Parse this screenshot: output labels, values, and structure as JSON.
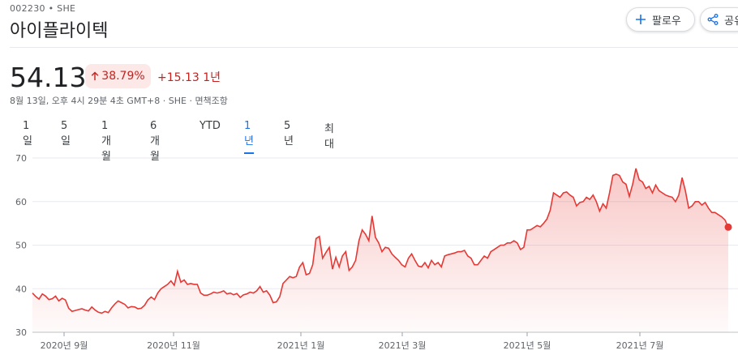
{
  "header": {
    "ticker": "002230 • SHE",
    "company": "아이플라이텍",
    "follow_label": "팔로우",
    "share_label": "공유"
  },
  "quote": {
    "price": "54.13",
    "change_pct": "38.79%",
    "change_abs": "+15.13 1년",
    "meta": "8월 13일, 오후 4시 29분 4초 GMT+8 · SHE · 면책조항",
    "color_down_up": "#c5221f",
    "badge_bg": "#fce8e6"
  },
  "tabs": [
    {
      "label": "1일",
      "active": false
    },
    {
      "label": "5일",
      "active": false
    },
    {
      "label": "1개월",
      "active": false
    },
    {
      "label": "6개월",
      "active": false
    },
    {
      "label": "YTD",
      "active": false
    },
    {
      "label": "1년",
      "active": true
    },
    {
      "label": "5년",
      "active": false
    },
    {
      "label": "최대",
      "active": false
    }
  ],
  "chart_data": {
    "type": "area",
    "ylim": [
      30,
      70
    ],
    "yticks": [
      "30",
      "40",
      "50",
      "60",
      "70"
    ],
    "xticks": [
      "2020년 9월",
      "2020년 11월",
      "2021년 1월",
      "2021년 3월",
      "2021년 5월",
      "2021년 7월"
    ],
    "line_color": "#e53935",
    "grid": true,
    "series": [
      {
        "values": [
          39.0,
          38.2,
          37.6,
          38.8,
          38.3,
          37.5,
          37.7,
          38.3,
          37.2,
          37.8,
          37.4,
          35.5,
          34.8,
          35.0,
          35.2,
          35.4,
          35.1,
          34.9,
          35.8,
          35.1,
          34.6,
          34.4,
          34.8,
          34.5,
          35.6,
          36.5,
          37.2,
          36.8,
          36.4,
          35.6,
          35.9,
          35.8,
          35.4,
          35.5,
          36.2,
          37.4,
          38.1,
          37.5,
          39.0,
          40.0,
          40.5,
          41.0,
          41.8,
          40.8,
          44.0,
          41.5,
          42.0,
          41.0,
          41.2,
          41.0,
          41.0,
          39.0,
          38.5,
          38.5,
          38.8,
          39.2,
          39.0,
          39.2,
          39.5,
          38.8,
          39.0,
          38.6,
          38.9,
          38.0,
          38.6,
          38.8,
          39.2,
          39.0,
          39.5,
          40.5,
          39.2,
          39.5,
          38.5,
          36.8,
          37.0,
          38.2,
          41.2,
          42.0,
          42.8,
          42.5,
          42.8,
          45.0,
          46.0,
          43.2,
          43.5,
          45.5,
          51.5,
          52.0,
          47.0,
          48.3,
          49.5,
          44.5,
          47.2,
          45.0,
          47.5,
          48.5,
          44.2,
          45.0,
          46.5,
          51.0,
          53.5,
          52.5,
          51.0,
          56.7,
          51.8,
          50.5,
          48.5,
          49.5,
          49.3,
          48.0,
          47.2,
          46.5,
          45.5,
          45.0,
          47.0,
          48.0,
          46.5,
          45.2,
          45.0,
          46.0,
          44.8,
          46.5,
          45.5,
          46.0,
          45.0,
          47.5,
          47.8,
          48.0,
          48.2,
          48.5,
          48.5,
          48.8,
          47.5,
          47.0,
          45.5,
          45.5,
          46.5,
          47.5,
          47.0,
          48.5,
          49.0,
          49.5,
          50.0,
          50.0,
          50.5,
          50.5,
          51.0,
          50.5,
          49.0,
          49.5,
          53.5,
          53.5,
          54.0,
          54.5,
          54.2,
          55.0,
          56.0,
          58.0,
          62.0,
          61.5,
          61.0,
          62.0,
          62.2,
          61.5,
          61.0,
          59.0,
          59.8,
          60.0,
          61.0,
          60.5,
          61.5,
          60.0,
          57.8,
          59.5,
          58.5,
          62.0,
          66.0,
          66.3,
          66.0,
          64.5,
          64.0,
          61.2,
          64.0,
          67.6,
          65.0,
          64.5,
          63.0,
          63.5,
          62.0,
          63.8,
          62.5,
          62.0,
          61.5,
          61.2,
          61.0,
          60.0,
          61.5,
          65.5,
          62.5,
          58.5,
          59.0,
          60.0,
          60.0,
          59.2,
          59.8,
          58.5,
          57.5,
          57.5,
          57.0,
          56.5,
          55.8,
          54.13
        ]
      }
    ]
  }
}
